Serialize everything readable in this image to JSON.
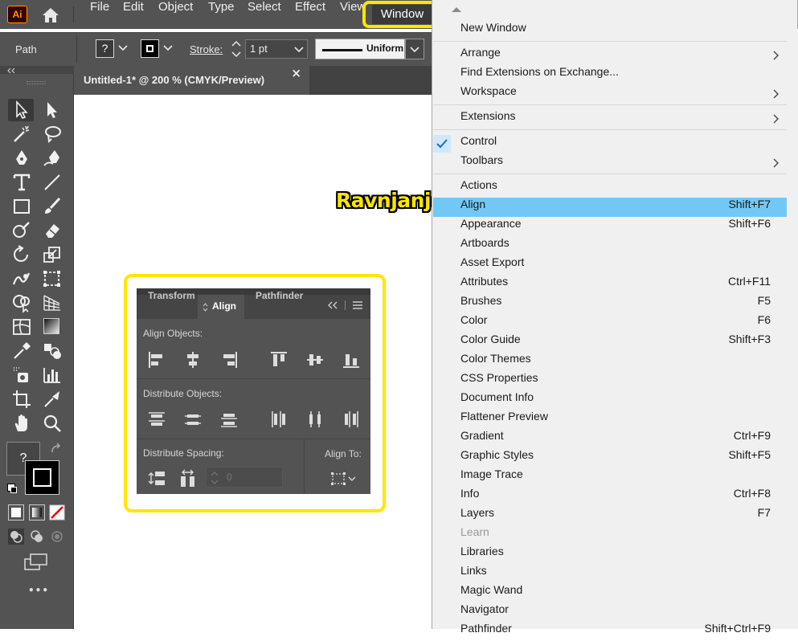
{
  "app": {
    "logo_text": "Ai"
  },
  "menubar": {
    "items": [
      "File",
      "Edit",
      "Object",
      "Type",
      "Select",
      "Effect",
      "View"
    ],
    "window_label": "Window"
  },
  "control": {
    "selection_type": "Path",
    "fill_label": "?",
    "stroke_label": "Stroke:",
    "stroke_value": "1 pt",
    "profile_label": "Uniform"
  },
  "document": {
    "tab_title": "Untitled-1* @ 200 % (CMYK/Preview)",
    "close_glyph": "×"
  },
  "toolbar": {
    "fill_stroke_label": "?",
    "more_glyph": "•••"
  },
  "annotation": {
    "text": "Ravnjanje",
    "color": "#ffe600"
  },
  "align_panel": {
    "tabs": [
      "Transform",
      "Align",
      "Pathfinder"
    ],
    "active_tab": "Align",
    "sections": {
      "align_objects": "Align Objects:",
      "distribute_objects": "Distribute Objects:",
      "distribute_spacing": "Distribute Spacing:",
      "align_to": "Align To:"
    },
    "spacing_value": "0"
  },
  "window_menu": {
    "groups": [
      [
        {
          "label": "New Window"
        }
      ],
      [
        {
          "label": "Arrange",
          "submenu": true
        },
        {
          "label": "Find Extensions on Exchange..."
        },
        {
          "label": "Workspace",
          "submenu": true
        }
      ],
      [
        {
          "label": "Extensions",
          "submenu": true
        }
      ],
      [
        {
          "label": "Control",
          "checked": true
        },
        {
          "label": "Toolbars",
          "submenu": true
        }
      ],
      [
        {
          "label": "Actions"
        },
        {
          "label": "Align",
          "shortcut": "Shift+F7",
          "highlighted": true
        },
        {
          "label": "Appearance",
          "shortcut": "Shift+F6"
        },
        {
          "label": "Artboards"
        },
        {
          "label": "Asset Export"
        },
        {
          "label": "Attributes",
          "shortcut": "Ctrl+F11"
        },
        {
          "label": "Brushes",
          "shortcut": "F5"
        },
        {
          "label": "Color",
          "shortcut": "F6"
        },
        {
          "label": "Color Guide",
          "shortcut": "Shift+F3"
        },
        {
          "label": "Color Themes"
        },
        {
          "label": "CSS Properties"
        },
        {
          "label": "Document Info"
        },
        {
          "label": "Flattener Preview"
        },
        {
          "label": "Gradient",
          "shortcut": "Ctrl+F9"
        },
        {
          "label": "Graphic Styles",
          "shortcut": "Shift+F5"
        },
        {
          "label": "Image Trace"
        },
        {
          "label": "Info",
          "shortcut": "Ctrl+F8"
        },
        {
          "label": "Layers",
          "shortcut": "F7"
        },
        {
          "label": "Learn",
          "disabled": true
        },
        {
          "label": "Libraries"
        },
        {
          "label": "Links"
        },
        {
          "label": "Magic Wand"
        },
        {
          "label": "Navigator"
        },
        {
          "label": "Pathfinder",
          "shortcut": "Shift+Ctrl+F9"
        }
      ]
    ],
    "colors": {
      "highlight": "#72c8f4",
      "check": "#1a6fb5"
    }
  }
}
